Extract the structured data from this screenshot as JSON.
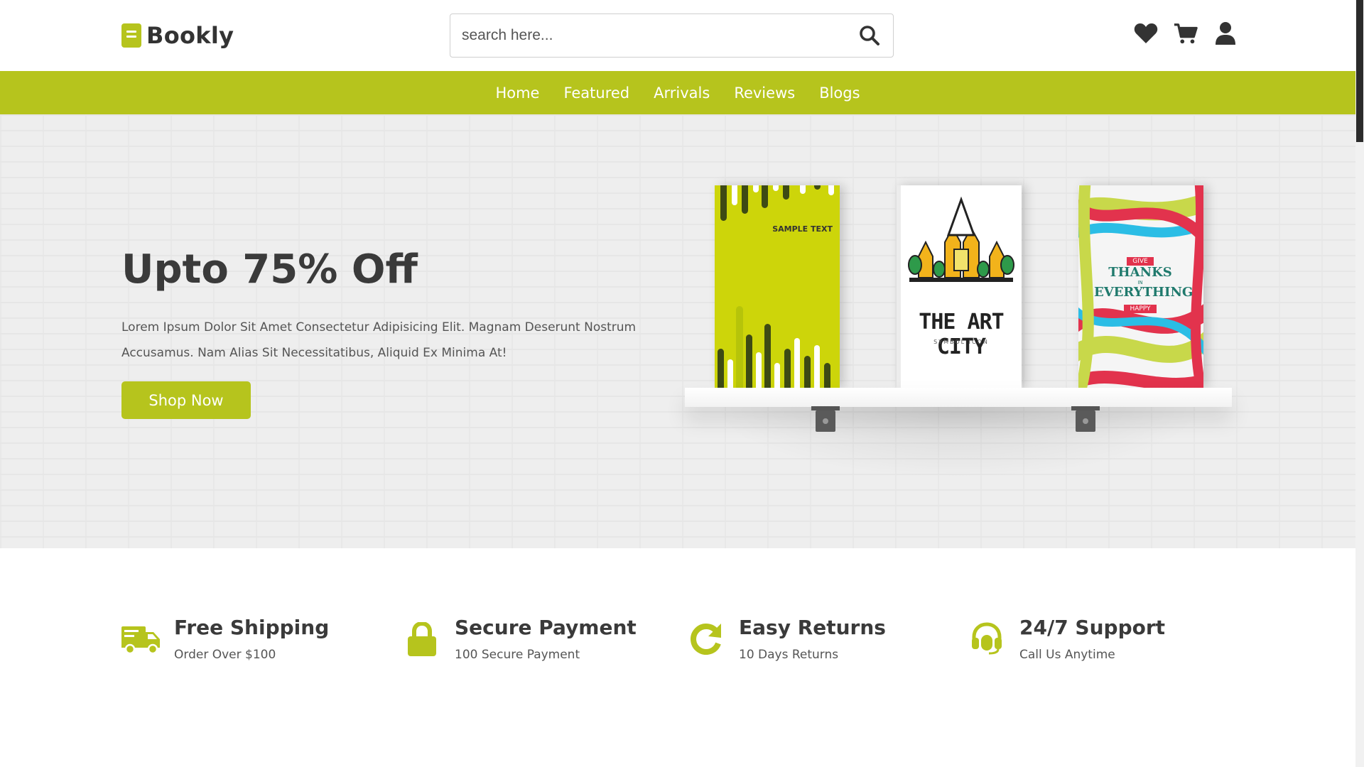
{
  "brand": {
    "name": "Bookly",
    "icon": "book-icon",
    "accent_color": "#b6c41d"
  },
  "search": {
    "placeholder": "search here...",
    "icon": "search-icon"
  },
  "header_icons": [
    "heart-icon",
    "cart-icon",
    "user-icon"
  ],
  "nav": {
    "items": [
      {
        "label": "Home"
      },
      {
        "label": "Featured"
      },
      {
        "label": "Arrivals"
      },
      {
        "label": "Reviews"
      },
      {
        "label": "Blogs"
      }
    ]
  },
  "hero": {
    "title": "Upto 75% Off",
    "description": "Lorem Ipsum Dolor Sit Amet Consectetur Adipisicing Elit. Magnam Deserunt Nostrum Accusamus. Nam Alias Sit Necessitatibus, Aliquid Ex Minima At!",
    "cta_label": "Shop Now",
    "books": [
      {
        "cover_text": "SAMPLE TEXT"
      },
      {
        "cover_title": "THE ART CITY",
        "cover_subtitle": "SYMBOL ICON"
      },
      {
        "cover_line1": "GIVE",
        "cover_line2": "THANKS",
        "cover_line3": "IN",
        "cover_line4": "EVERYTHING",
        "cover_line5": "HAPPY"
      }
    ]
  },
  "features": [
    {
      "icon": "truck-icon",
      "title": "Free Shipping",
      "subtitle": "Order Over $100"
    },
    {
      "icon": "lock-icon",
      "title": "Secure Payment",
      "subtitle": "100 Secure Payment"
    },
    {
      "icon": "redo-icon",
      "title": "Easy Returns",
      "subtitle": "10 Days Returns"
    },
    {
      "icon": "headset-icon",
      "title": "24/7 Support",
      "subtitle": "Call Us Anytime"
    }
  ]
}
